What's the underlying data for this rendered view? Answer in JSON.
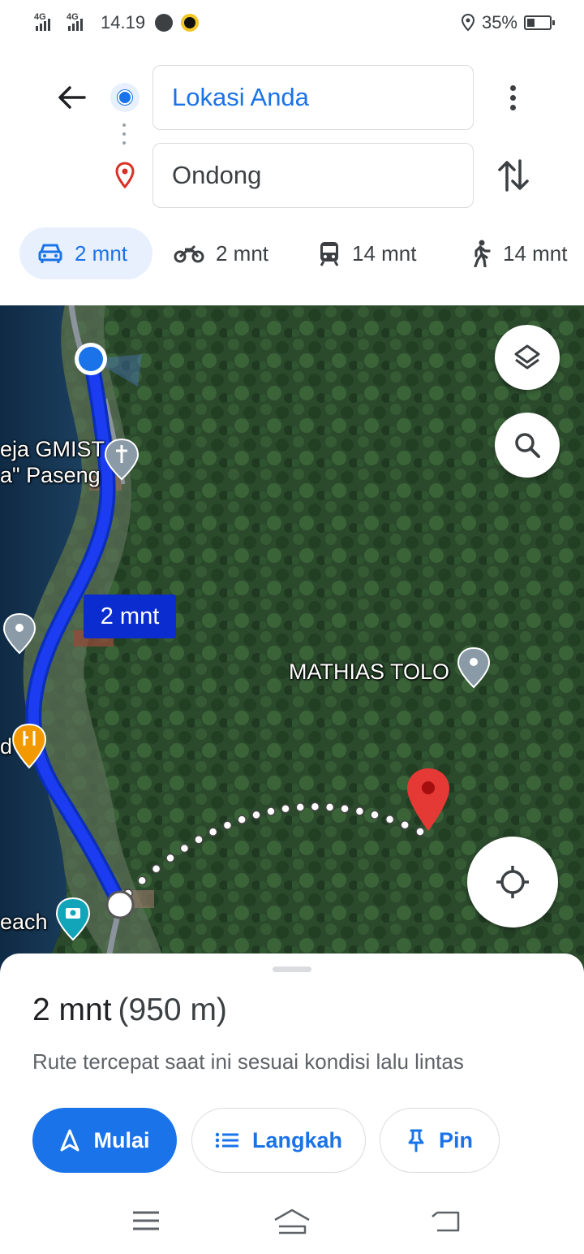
{
  "status_bar": {
    "network_1": "4G",
    "network_2": "4G",
    "time": "14.19",
    "battery": "35%",
    "battery_level": 0.35
  },
  "directions": {
    "origin": "Lokasi Anda",
    "destination": "Ondong"
  },
  "modes": [
    {
      "name": "car",
      "label": "2 mnt",
      "icon": "car-icon",
      "active": true
    },
    {
      "name": "motorcycle",
      "label": "2 mnt",
      "icon": "motorcycle-icon",
      "active": false
    },
    {
      "name": "transit",
      "label": "14 mnt",
      "icon": "train-icon",
      "active": false
    },
    {
      "name": "walk",
      "label": "14 mnt",
      "icon": "walking-icon",
      "active": false
    }
  ],
  "map": {
    "labels": {
      "church_line1": "eja GMIST",
      "church_line2": "a\" Paseng",
      "place": "MATHIAS TOLO",
      "food": "d",
      "beach": "each"
    },
    "route_badge": "2 mnt",
    "colors": {
      "route": "#1b3cf0",
      "route_badge": "#0b2ccf",
      "destination_pin": "#e53935"
    }
  },
  "sheet": {
    "duration": "2 mnt",
    "distance": "(950 m)",
    "subtitle": "Rute tercepat saat ini sesuai kondisi lalu lintas",
    "buttons": {
      "start": "Mulai",
      "steps": "Langkah",
      "pin": "Pin"
    }
  },
  "accent_color": "#1a73e8"
}
